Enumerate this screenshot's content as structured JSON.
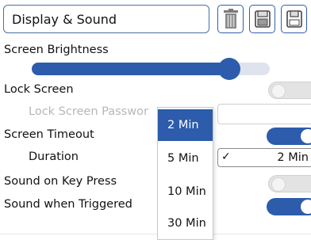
{
  "header": {
    "title": "Display & Sound",
    "buttons": [
      {
        "name": "delete",
        "icon": "trash-icon"
      },
      {
        "name": "open",
        "icon": "folder-icon"
      },
      {
        "name": "save",
        "icon": "save-icon"
      }
    ]
  },
  "settings": {
    "brightness": {
      "label": "Screen Brightness",
      "value_fraction": 0.83
    },
    "lock_screen": {
      "label": "Lock Screen",
      "enabled": false
    },
    "lock_password": {
      "label": "Lock Screen Passwor",
      "value": ""
    },
    "screen_timeout": {
      "label": "Screen Timeout",
      "enabled": true
    },
    "duration": {
      "label": "Duration",
      "selected": "2 Min"
    },
    "sound_keypress": {
      "label": "Sound on Key Press",
      "enabled": false
    },
    "sound_triggered": {
      "label": "Sound when Triggered",
      "enabled": true
    }
  },
  "duration_menu": {
    "options": [
      "2 Min",
      "5 Min",
      "10 Min",
      "30 Min"
    ],
    "selected_index": 0
  },
  "colors": {
    "accent": "#2c5cab",
    "track": "#dfe3ee",
    "toggle_off": "#e3e3e3",
    "disabled_text": "#b7b7b7"
  }
}
